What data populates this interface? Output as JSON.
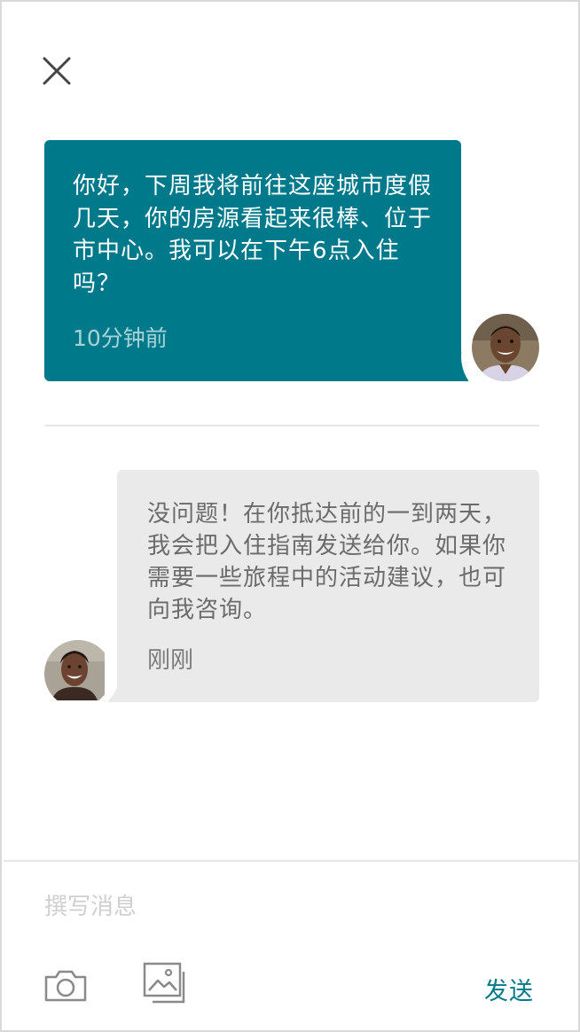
{
  "header": {
    "close_icon": "close-icon"
  },
  "messages": [
    {
      "sender": "host",
      "text": "你好，下周我将前往这座城市度假几天，你的房源看起来很棒、位于市中心。我可以在下午6点入住吗？",
      "time": "10分钟前",
      "bubble_color": "#00798A",
      "text_color": "#FFFFFF",
      "time_color": "#A7D3D8",
      "avatar_icon": "avatar-man"
    },
    {
      "sender": "guest",
      "text": "没问题！在你抵达前的一到两天，我会把入住指南发送给你。如果你需要一些旅程中的活动建议，也可向我咨询。",
      "time": "刚刚",
      "bubble_color": "#EAEAEA",
      "text_color": "#6B6B6B",
      "avatar_icon": "avatar-woman"
    }
  ],
  "composer": {
    "placeholder": "撰写消息",
    "camera_icon": "camera-icon",
    "gallery_icon": "image-gallery-icon",
    "send_label": "发送",
    "accent_color": "#00798A"
  }
}
